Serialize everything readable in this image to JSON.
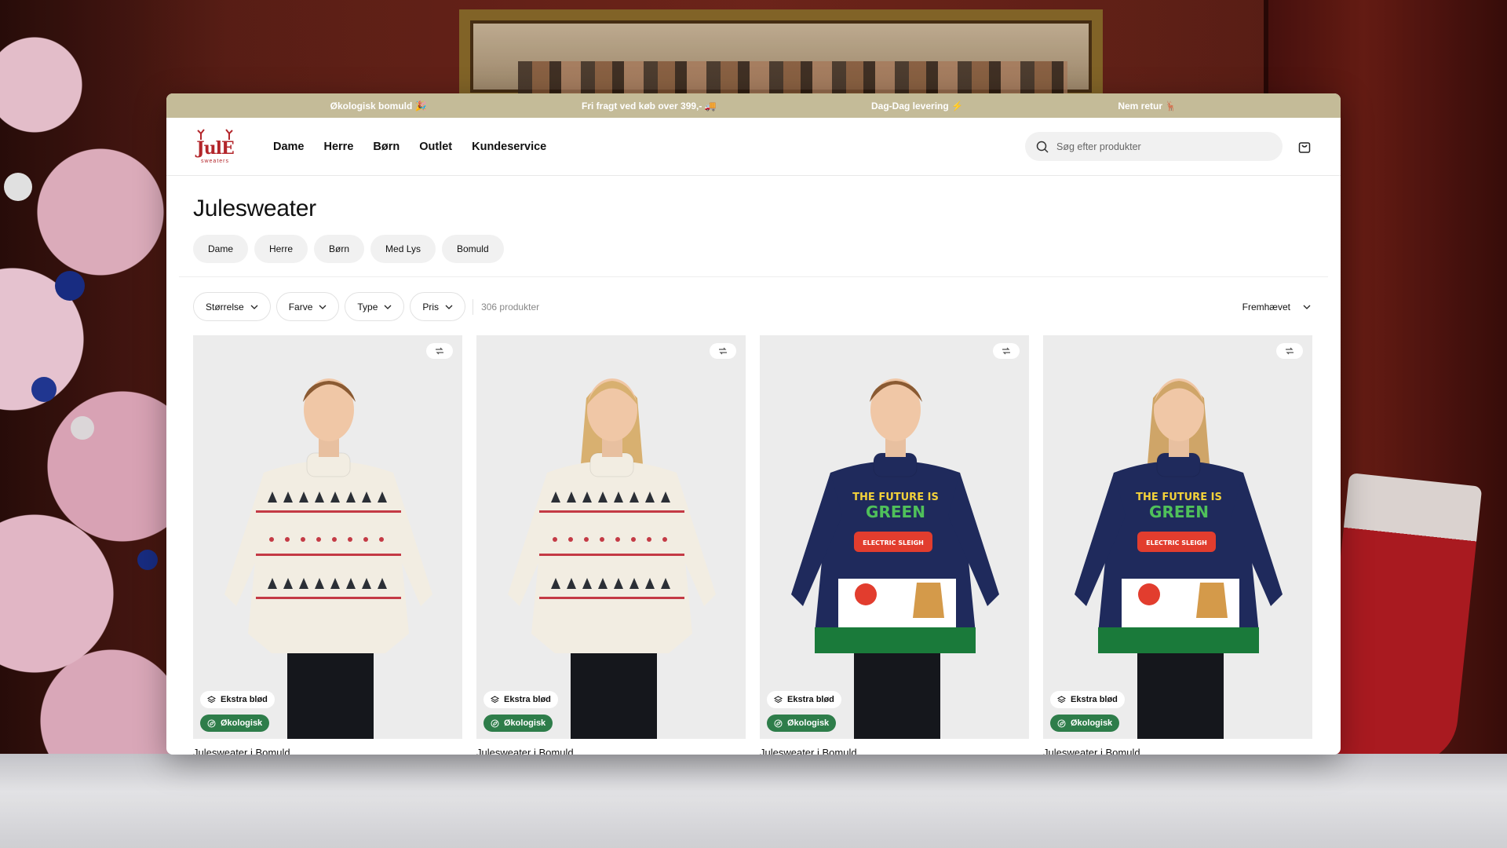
{
  "announcement": [
    "Økologisk bomuld 🎉",
    "Fri fragt ved køb over 399,- 🚚",
    "Dag-Dag levering ⚡",
    "Nem retur 🦌"
  ],
  "logo": {
    "line1": "JulE",
    "line2": "sweaters"
  },
  "nav": [
    "Dame",
    "Herre",
    "Børn",
    "Outlet",
    "Kundeservice"
  ],
  "search": {
    "placeholder": "Søg efter produkter",
    "icon": "search-icon"
  },
  "cart_icon": "cart-icon",
  "page_title": "Julesweater",
  "categories": [
    "Dame",
    "Herre",
    "Børn",
    "Med Lys",
    "Bomuld"
  ],
  "filters": [
    "Størrelse",
    "Farve",
    "Type",
    "Pris"
  ],
  "product_count": "306 produkter",
  "sort": {
    "label": "Fremhævet"
  },
  "products": [
    {
      "name": "Julesweater i Bomuld",
      "badges": [
        "Ekstra blød",
        "Økologisk"
      ],
      "sweater": {
        "base": "#f2ede2",
        "accent": "#c43a45",
        "dark": "#2b2f36"
      }
    },
    {
      "name": "Julesweater i Bomuld",
      "badges": [
        "Ekstra blød",
        "Økologisk"
      ],
      "sweater": {
        "base": "#f2ede2",
        "accent": "#c43a45",
        "dark": "#2b2f36"
      }
    },
    {
      "name": "Julesweater i Bomuld",
      "badges": [
        "Ekstra blød",
        "Økologisk"
      ],
      "sweater": {
        "base": "#1f2a5c",
        "accent": "#e23d2e",
        "dark": "#1a7a3a",
        "text1": "THE FUTURE IS",
        "text2": "GREEN",
        "text3": "ELECTRIC SLEIGH"
      }
    },
    {
      "name": "Julesweater i Bomuld",
      "badges": [
        "Ekstra blød",
        "Økologisk"
      ],
      "sweater": {
        "base": "#1f2a5c",
        "accent": "#e23d2e",
        "dark": "#1a7a3a",
        "text1": "THE FUTURE IS",
        "text2": "GREEN",
        "text3": "ELECTRIC SLEIGH"
      }
    }
  ],
  "colors": {
    "announcement_bg": "#c4bb98",
    "organic_badge": "#2e7d4a",
    "logo_red": "#b3262b"
  }
}
